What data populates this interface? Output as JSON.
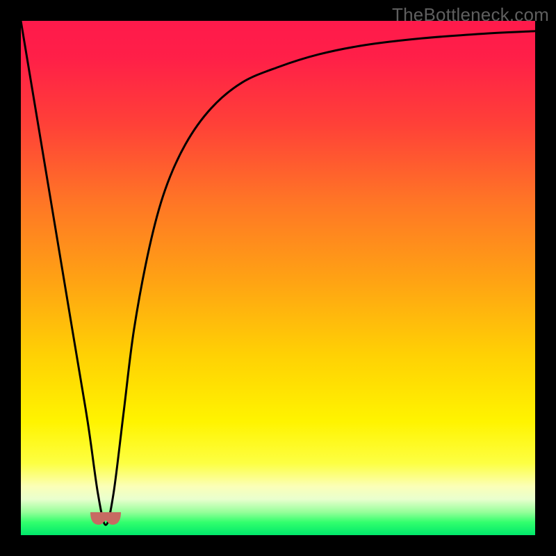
{
  "watermark": "TheBottleneck.com",
  "colors": {
    "frame_bg": "#000000",
    "curve_stroke": "#000000",
    "marker_fill": "#c76a62",
    "gradient_stops": [
      {
        "offset": 0.0,
        "color": "#ff1a4b"
      },
      {
        "offset": 0.07,
        "color": "#ff1f48"
      },
      {
        "offset": 0.2,
        "color": "#ff4038"
      },
      {
        "offset": 0.35,
        "color": "#ff7526"
      },
      {
        "offset": 0.5,
        "color": "#ffa114"
      },
      {
        "offset": 0.65,
        "color": "#ffd104"
      },
      {
        "offset": 0.78,
        "color": "#fff400"
      },
      {
        "offset": 0.86,
        "color": "#fdff42"
      },
      {
        "offset": 0.905,
        "color": "#fbffb7"
      },
      {
        "offset": 0.93,
        "color": "#e9ffce"
      },
      {
        "offset": 0.955,
        "color": "#97ff9a"
      },
      {
        "offset": 0.975,
        "color": "#32ff6d"
      },
      {
        "offset": 1.0,
        "color": "#00e86b"
      }
    ]
  },
  "chart_data": {
    "type": "line",
    "title": "",
    "xlabel": "",
    "ylabel": "",
    "xlim": [
      0,
      100
    ],
    "ylim": [
      0,
      100
    ],
    "series": [
      {
        "name": "bottleneck-curve",
        "x": [
          0,
          5,
          10,
          13,
          15,
          16.5,
          18,
          20,
          22,
          25,
          28,
          32,
          37,
          43,
          50,
          58,
          67,
          78,
          90,
          100
        ],
        "y": [
          100,
          70,
          40,
          22,
          8,
          2,
          8,
          24,
          40,
          56,
          67,
          76,
          83,
          88,
          91,
          93.5,
          95.3,
          96.6,
          97.5,
          98
        ]
      }
    ],
    "annotations": [
      {
        "name": "optimal-marker",
        "x": 16.5,
        "y": 2,
        "shape": "cup"
      }
    ],
    "grid": false
  }
}
